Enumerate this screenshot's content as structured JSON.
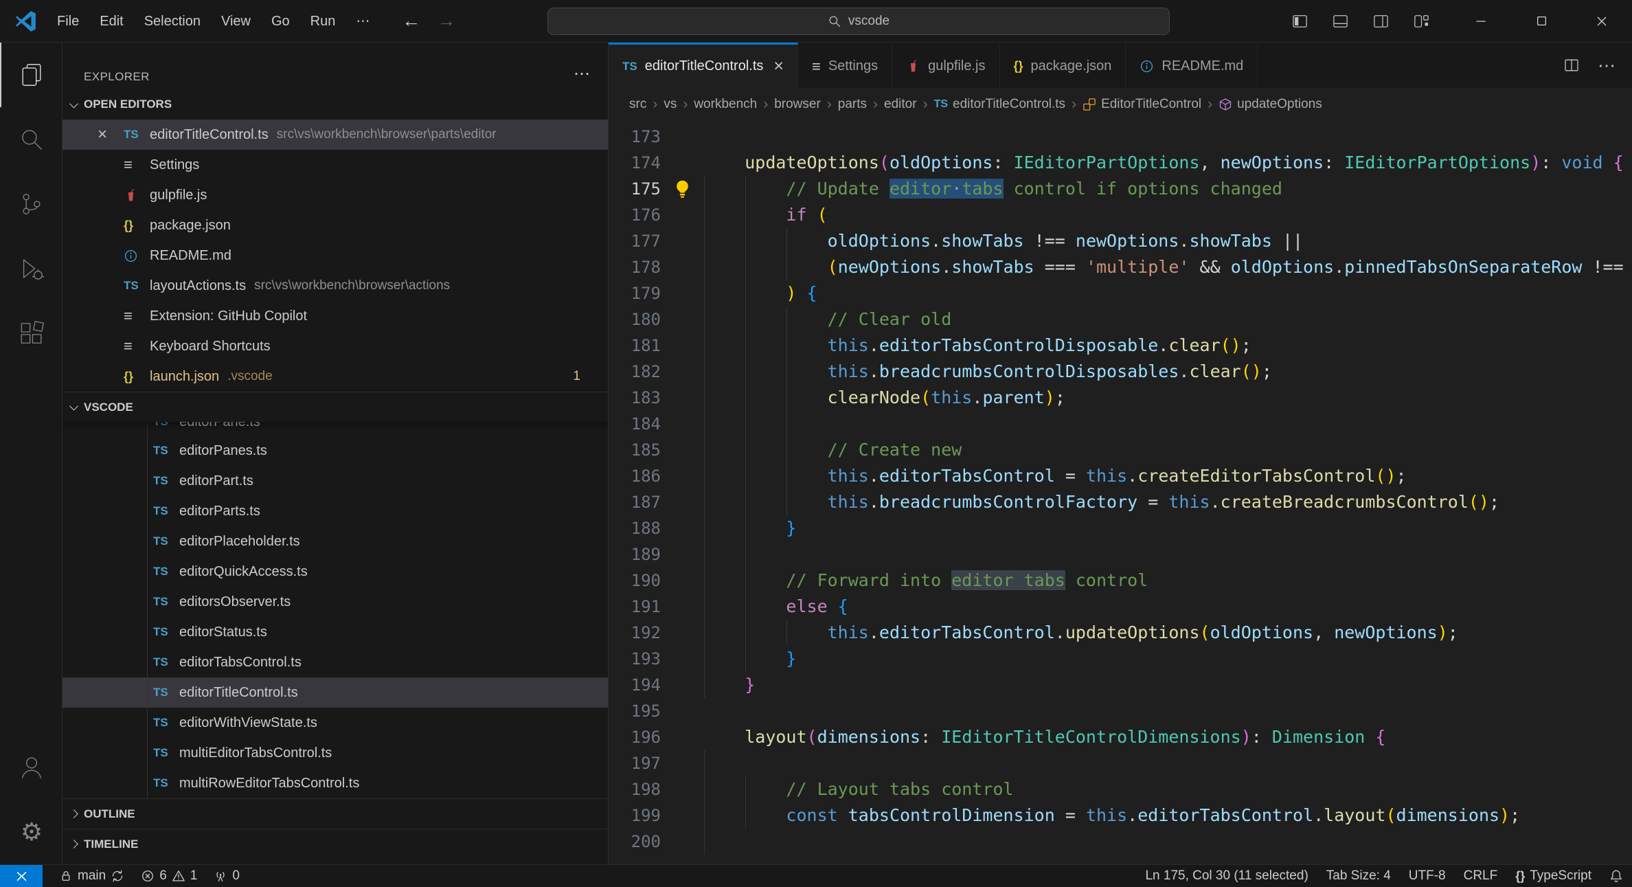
{
  "title_bar": {
    "menus": [
      "File",
      "Edit",
      "Selection",
      "View",
      "Go",
      "Run"
    ],
    "more_label": "⋯",
    "search": {
      "value": "vscode"
    }
  },
  "activity_bar": {
    "top": [
      {
        "name": "explorer",
        "active": true
      },
      {
        "name": "search",
        "active": false
      },
      {
        "name": "source-control",
        "active": false
      },
      {
        "name": "run-debug",
        "active": false
      },
      {
        "name": "extensions",
        "active": false
      }
    ],
    "bottom": [
      {
        "name": "account",
        "active": false
      },
      {
        "name": "settings-gear",
        "active": false
      }
    ]
  },
  "sidebar": {
    "title": "EXPLORER",
    "open_editors": {
      "label": "OPEN EDITORS",
      "items": [
        {
          "icon": "ts",
          "name": "editorTitleControl.ts",
          "desc": "src\\vs\\workbench\\browser\\parts\\editor",
          "selected": true,
          "close": true
        },
        {
          "icon": "list",
          "name": "Settings"
        },
        {
          "icon": "gulp",
          "name": "gulpfile.js"
        },
        {
          "icon": "json",
          "name": "package.json"
        },
        {
          "icon": "info",
          "name": "README.md"
        },
        {
          "icon": "ts",
          "name": "layoutActions.ts",
          "desc": "src\\vs\\workbench\\browser\\actions"
        },
        {
          "icon": "list",
          "name": "Extension: GitHub Copilot"
        },
        {
          "icon": "list",
          "name": "Keyboard Shortcuts"
        },
        {
          "icon": "json",
          "name": "launch.json",
          "desc": ".vscode",
          "modified": true,
          "badge": "1"
        }
      ]
    },
    "project": {
      "label": "VSCODE",
      "clipped_item": {
        "icon": "ts",
        "name": "editorPane.ts"
      },
      "items": [
        {
          "icon": "ts",
          "name": "editorPanes.ts"
        },
        {
          "icon": "ts",
          "name": "editorPart.ts"
        },
        {
          "icon": "ts",
          "name": "editorParts.ts"
        },
        {
          "icon": "ts",
          "name": "editorPlaceholder.ts"
        },
        {
          "icon": "ts",
          "name": "editorQuickAccess.ts"
        },
        {
          "icon": "ts",
          "name": "editorsObserver.ts"
        },
        {
          "icon": "ts",
          "name": "editorStatus.ts"
        },
        {
          "icon": "ts",
          "name": "editorTabsControl.ts"
        },
        {
          "icon": "ts",
          "name": "editorTitleControl.ts",
          "selected": true
        },
        {
          "icon": "ts",
          "name": "editorWithViewState.ts"
        },
        {
          "icon": "ts",
          "name": "multiEditorTabsControl.ts"
        },
        {
          "icon": "ts",
          "name": "multiRowEditorTabsControl.ts"
        }
      ]
    },
    "outline": {
      "label": "OUTLINE"
    },
    "timeline": {
      "label": "TIMELINE"
    }
  },
  "editor": {
    "tabs": [
      {
        "icon": "ts",
        "label": "editorTitleControl.ts",
        "active": true,
        "close": true
      },
      {
        "icon": "list",
        "label": "Settings"
      },
      {
        "icon": "gulp",
        "label": "gulpfile.js"
      },
      {
        "icon": "json",
        "label": "package.json"
      },
      {
        "icon": "info",
        "label": "README.md"
      }
    ],
    "breadcrumbs": [
      {
        "label": "src"
      },
      {
        "label": "vs"
      },
      {
        "label": "workbench"
      },
      {
        "label": "browser"
      },
      {
        "label": "parts"
      },
      {
        "label": "editor"
      },
      {
        "icon": "ts",
        "label": "editorTitleControl.ts"
      },
      {
        "icon": "symbol-class",
        "label": "EditorTitleControl"
      },
      {
        "icon": "symbol-method",
        "label": "updateOptions"
      }
    ],
    "code": {
      "lines": [
        {
          "n": 173,
          "i": 0,
          "g": [],
          "s": []
        },
        {
          "n": 174,
          "i": 1,
          "g": [],
          "s": [
            [
              "fn",
              "updateOptions"
            ],
            [
              "b2",
              "("
            ],
            [
              "v",
              "oldOptions"
            ],
            [
              "o",
              ": "
            ],
            [
              "ty",
              "IEditorPartOptions"
            ],
            [
              "o",
              ", "
            ],
            [
              "v",
              "newOptions"
            ],
            [
              "o",
              ": "
            ],
            [
              "ty",
              "IEditorPartOptions"
            ],
            [
              "b2",
              ")"
            ],
            [
              "o",
              ": "
            ],
            [
              "st",
              "void"
            ],
            [
              "o",
              " "
            ],
            [
              "b2",
              "{"
            ]
          ]
        },
        {
          "n": 175,
          "i": 2,
          "g": [
            0,
            1
          ],
          "bulb": true,
          "cur": true,
          "s": [
            [
              "cm",
              "// Update "
            ],
            [
              "cm sel",
              "editor"
            ],
            [
              "ws sel",
              "·"
            ],
            [
              "cm sel",
              "tabs"
            ],
            [
              "cm",
              " control if options changed"
            ]
          ]
        },
        {
          "n": 176,
          "i": 2,
          "g": [
            0,
            1
          ],
          "s": [
            [
              "kw",
              "if"
            ],
            [
              "o",
              " "
            ],
            [
              "b1",
              "("
            ]
          ]
        },
        {
          "n": 177,
          "i": 3,
          "g": [
            0,
            1,
            2
          ],
          "s": [
            [
              "v",
              "oldOptions"
            ],
            [
              "o",
              "."
            ],
            [
              "v",
              "showTabs"
            ],
            [
              "o",
              " !== "
            ],
            [
              "v",
              "newOptions"
            ],
            [
              "o",
              "."
            ],
            [
              "v",
              "showTabs"
            ],
            [
              "o",
              " ||"
            ]
          ]
        },
        {
          "n": 178,
          "i": 3,
          "g": [
            0,
            1,
            2
          ],
          "s": [
            [
              "b1",
              "("
            ],
            [
              "v",
              "newOptions"
            ],
            [
              "o",
              "."
            ],
            [
              "v",
              "showTabs"
            ],
            [
              "o",
              " === "
            ],
            [
              "str",
              "'multiple'"
            ],
            [
              "o",
              " && "
            ],
            [
              "v",
              "oldOptions"
            ],
            [
              "o",
              "."
            ],
            [
              "v",
              "pinnedTabsOnSeparateRow"
            ],
            [
              "o",
              " !=="
            ]
          ]
        },
        {
          "n": 179,
          "i": 2,
          "g": [
            0,
            1
          ],
          "s": [
            [
              "b1",
              ")"
            ],
            [
              "o",
              " "
            ],
            [
              "b3",
              "{"
            ]
          ]
        },
        {
          "n": 180,
          "i": 3,
          "g": [
            0,
            1,
            2
          ],
          "s": [
            [
              "cm",
              "// Clear old"
            ]
          ]
        },
        {
          "n": 181,
          "i": 3,
          "g": [
            0,
            1,
            2
          ],
          "s": [
            [
              "st",
              "this"
            ],
            [
              "o",
              "."
            ],
            [
              "v",
              "editorTabsControlDisposable"
            ],
            [
              "o",
              "."
            ],
            [
              "fn",
              "clear"
            ],
            [
              "b1",
              "()"
            ],
            [
              "o",
              ";"
            ]
          ]
        },
        {
          "n": 182,
          "i": 3,
          "g": [
            0,
            1,
            2
          ],
          "s": [
            [
              "st",
              "this"
            ],
            [
              "o",
              "."
            ],
            [
              "v",
              "breadcrumbsControlDisposables"
            ],
            [
              "o",
              "."
            ],
            [
              "fn",
              "clear"
            ],
            [
              "b1",
              "()"
            ],
            [
              "o",
              ";"
            ]
          ]
        },
        {
          "n": 183,
          "i": 3,
          "g": [
            0,
            1,
            2
          ],
          "s": [
            [
              "fn",
              "clearNode"
            ],
            [
              "b1",
              "("
            ],
            [
              "st",
              "this"
            ],
            [
              "o",
              "."
            ],
            [
              "v",
              "parent"
            ],
            [
              "b1",
              ")"
            ],
            [
              "o",
              ";"
            ]
          ]
        },
        {
          "n": 184,
          "i": 0,
          "g": [
            0,
            1,
            2
          ],
          "s": []
        },
        {
          "n": 185,
          "i": 3,
          "g": [
            0,
            1,
            2
          ],
          "s": [
            [
              "cm",
              "// Create new"
            ]
          ]
        },
        {
          "n": 186,
          "i": 3,
          "g": [
            0,
            1,
            2
          ],
          "s": [
            [
              "st",
              "this"
            ],
            [
              "o",
              "."
            ],
            [
              "v",
              "editorTabsControl"
            ],
            [
              "o",
              " = "
            ],
            [
              "st",
              "this"
            ],
            [
              "o",
              "."
            ],
            [
              "fn",
              "createEditorTabsControl"
            ],
            [
              "b1",
              "()"
            ],
            [
              "o",
              ";"
            ]
          ]
        },
        {
          "n": 187,
          "i": 3,
          "g": [
            0,
            1,
            2
          ],
          "s": [
            [
              "st",
              "this"
            ],
            [
              "o",
              "."
            ],
            [
              "v",
              "breadcrumbsControlFactory"
            ],
            [
              "o",
              " = "
            ],
            [
              "st",
              "this"
            ],
            [
              "o",
              "."
            ],
            [
              "fn",
              "createBreadcrumbsControl"
            ],
            [
              "b1",
              "()"
            ],
            [
              "o",
              ";"
            ]
          ]
        },
        {
          "n": 188,
          "i": 2,
          "g": [
            0,
            1
          ],
          "s": [
            [
              "b3",
              "}"
            ]
          ]
        },
        {
          "n": 189,
          "i": 0,
          "g": [
            0,
            1
          ],
          "s": []
        },
        {
          "n": 190,
          "i": 2,
          "g": [
            0,
            1
          ],
          "s": [
            [
              "cm",
              "// Forward into "
            ],
            [
              "cm match",
              "editor tabs"
            ],
            [
              "cm",
              " control"
            ]
          ]
        },
        {
          "n": 191,
          "i": 2,
          "g": [
            0,
            1
          ],
          "s": [
            [
              "kw",
              "else"
            ],
            [
              "o",
              " "
            ],
            [
              "b3",
              "{"
            ]
          ]
        },
        {
          "n": 192,
          "i": 3,
          "g": [
            0,
            1,
            2
          ],
          "s": [
            [
              "st",
              "this"
            ],
            [
              "o",
              "."
            ],
            [
              "v",
              "editorTabsControl"
            ],
            [
              "o",
              "."
            ],
            [
              "fn",
              "updateOptions"
            ],
            [
              "b1",
              "("
            ],
            [
              "v",
              "oldOptions"
            ],
            [
              "o",
              ", "
            ],
            [
              "v",
              "newOptions"
            ],
            [
              "b1",
              ")"
            ],
            [
              "o",
              ";"
            ]
          ]
        },
        {
          "n": 193,
          "i": 2,
          "g": [
            0,
            1
          ],
          "s": [
            [
              "b3",
              "}"
            ]
          ]
        },
        {
          "n": 194,
          "i": 1,
          "g": [
            0
          ],
          "s": [
            [
              "b2",
              "}"
            ]
          ]
        },
        {
          "n": 195,
          "i": 0,
          "g": [],
          "s": []
        },
        {
          "n": 196,
          "i": 1,
          "g": [],
          "s": [
            [
              "fn",
              "layout"
            ],
            [
              "b2",
              "("
            ],
            [
              "v",
              "dimensions"
            ],
            [
              "o",
              ": "
            ],
            [
              "ty",
              "IEditorTitleControlDimensions"
            ],
            [
              "b2",
              ")"
            ],
            [
              "o",
              ": "
            ],
            [
              "ty",
              "Dimension"
            ],
            [
              "o",
              " "
            ],
            [
              "b2",
              "{"
            ]
          ]
        },
        {
          "n": 197,
          "i": 0,
          "g": [
            0
          ],
          "s": []
        },
        {
          "n": 198,
          "i": 2,
          "g": [
            0,
            1
          ],
          "s": [
            [
              "cm",
              "// Layout tabs control"
            ]
          ]
        },
        {
          "n": 199,
          "i": 2,
          "g": [
            0,
            1
          ],
          "s": [
            [
              "st",
              "const"
            ],
            [
              "o",
              " "
            ],
            [
              "v",
              "tabsControlDimension"
            ],
            [
              "o",
              " = "
            ],
            [
              "st",
              "this"
            ],
            [
              "o",
              "."
            ],
            [
              "v",
              "editorTabsControl"
            ],
            [
              "o",
              "."
            ],
            [
              "fn",
              "layout"
            ],
            [
              "b1",
              "("
            ],
            [
              "v",
              "dimensions"
            ],
            [
              "b1",
              ")"
            ],
            [
              "o",
              ";"
            ]
          ]
        },
        {
          "n": 200,
          "i": 0,
          "g": [
            0
          ],
          "s": []
        }
      ]
    }
  },
  "status_bar": {
    "branch": "main",
    "errors": "6",
    "warnings": "1",
    "ports": "0",
    "right_items": [
      "Ln 175, Col 30 (11 selected)",
      "Tab Size: 4",
      "UTF-8",
      "CRLF"
    ],
    "language": "TypeScript"
  },
  "colors": {
    "accent": "#0078d4",
    "remote_bg": "#0078d4",
    "modified": "#e2c08d"
  }
}
